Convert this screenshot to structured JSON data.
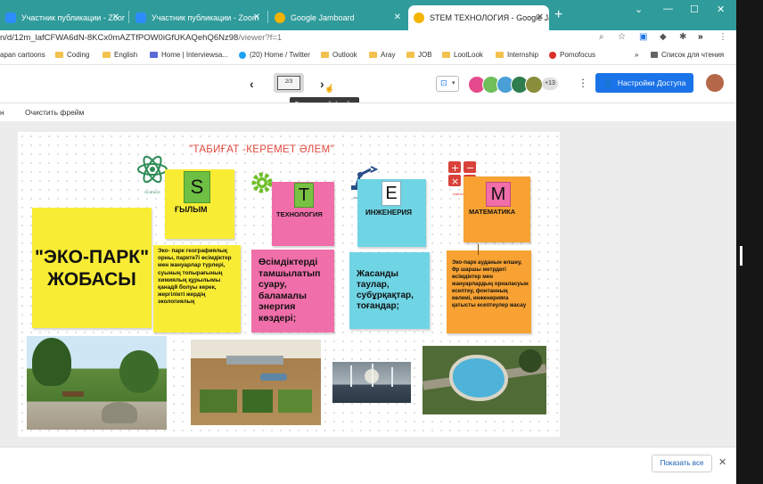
{
  "tabs": [
    {
      "label": "Участник публикации - Zoom",
      "icon": "zoom-icon",
      "active": false
    },
    {
      "label": "Участник публикации - Zoom",
      "icon": "zoom-icon",
      "active": false
    },
    {
      "label": "Google Jamboard",
      "icon": "jamboard-icon",
      "active": false
    },
    {
      "label": "STEM ТЕХНОЛОГИЯ - Google Ja",
      "icon": "jamboard-icon",
      "active": true
    }
  ],
  "address": {
    "url_prefix": "n/d/12m_lafCFWA6dN-8KCx0mAZTfPOW0iGfUKAQehQ6Nz98",
    "url_suffix": "/viewer?f=1"
  },
  "bookmarks": [
    "apan cartoons",
    "Coding",
    "English",
    "Home | Interviewsa...",
    "(20) Home / Twitter",
    "Outlook",
    "Aray",
    "JOB",
    "LootLook",
    "Internship",
    "Pomofocus",
    "»",
    "Список для чтения"
  ],
  "toolbar": {
    "frame_indicator": "2/3",
    "tooltip": "Следующий фрейм",
    "share_label": "Настройки Доступа",
    "more_avatars": "+13"
  },
  "subtoolbar": {
    "left_cut": "н",
    "clear_frame": "Очистить фрейм"
  },
  "board": {
    "title": "\"ТАБИҒАТ -КЕРЕМЕТ ӘЛЕМ\"",
    "eco_title": "\"ЭКО-ПАРК\" ЖОБАСЫ",
    "science_icon_caption": "SCIENCE",
    "engineering_icon_caption": "engineering",
    "math_icon_caption": "mathematics",
    "s_letter": "S",
    "s_caption": "ҒЫЛЫМ",
    "s_text": "Эко- парк географиялық орны, паркте7і өсімдіктер мен жануарлар түрлері, суының топырағының химиялық құрылымы қанадй болуы керек, жергілікті жердің экологиялық",
    "t_letter": "T",
    "t_caption": "ТЕХНОЛОГИЯ",
    "t_text": "Өсімдіктерді тамшылатып суару, баламалы энергия көздері;",
    "e_letter": "E",
    "e_caption": "ИНЖЕНЕРИЯ",
    "e_text": "Жасанды таулар, субұрқақтар, тоғандар;",
    "m_letter": "M",
    "m_caption": "МАТЕМАТИКА",
    "m_text": "Эко-парк ауданын өлшеу, Әр шаршы метрдегі өсімдіктер мен жануарлардың орналасуын есептеу, фонтанның көлемі, инженерияға қатысты есептеулер жасау"
  },
  "bottom": {
    "show_all": "Показать все"
  }
}
